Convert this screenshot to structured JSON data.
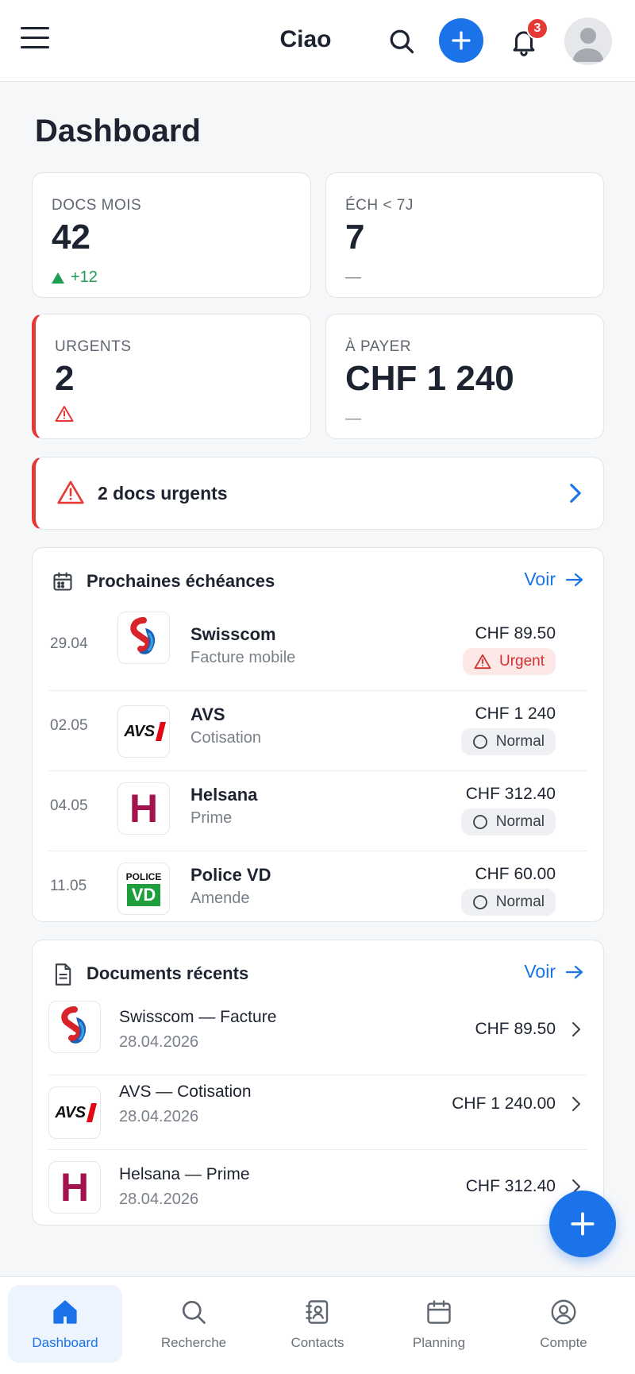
{
  "topbar": {
    "title": "Ciao",
    "notifications": "3"
  },
  "page": {
    "title": "Dashboard"
  },
  "stats": [
    {
      "label": "DOCS MOIS",
      "value": "42",
      "sub": "+12"
    },
    {
      "label": "ÉCH < 7J",
      "value": "7",
      "sub": "—"
    },
    {
      "label": "URGENTS",
      "value": "2",
      "sub": ""
    },
    {
      "label": "À PAYER",
      "value": "CHF 1 240",
      "sub": "—"
    }
  ],
  "banner": {
    "text": "2 docs urgents"
  },
  "deadlines": {
    "title": "Prochaines échéances",
    "see_label": "Voir",
    "items": [
      {
        "date": "29.04",
        "name": "Swisscom",
        "desc": "Facture mobile",
        "amount": "CHF 89.50",
        "status": "Urgent",
        "logo": "swisscom-logo"
      },
      {
        "date": "02.05",
        "name": "AVS",
        "desc": "Cotisation",
        "amount": "CHF 1 240",
        "status": "Normal",
        "logo": "avs-logo"
      },
      {
        "date": "04.05",
        "name": "Helsana",
        "desc": "Prime",
        "amount": "CHF 312.40",
        "status": "Normal",
        "logo": "helsana-logo"
      },
      {
        "date": "11.05",
        "name": "Police VD",
        "desc": "Amende",
        "amount": "CHF 60.00",
        "status": "Normal",
        "logo": "police-vd-logo"
      }
    ]
  },
  "recent": {
    "title": "Documents récents",
    "see_label": "Voir",
    "items": [
      {
        "name": "Swisscom — Facture",
        "date": "28.04.2026",
        "amount": "CHF 89.50",
        "logo": "swisscom-logo"
      },
      {
        "name": "AVS — Cotisation",
        "date": "28.04.2026",
        "amount": "CHF 1 240.00",
        "logo": "avs-logo"
      },
      {
        "name": "Helsana — Prime",
        "date": "28.04.2026",
        "amount": "CHF 312.40",
        "logo": "helsana-logo"
      }
    ]
  },
  "logos": {
    "avs_text": "AVS",
    "police_top": "POLICE",
    "police_bottom": "VD",
    "helsana_letter": "H"
  },
  "nav": [
    {
      "label": "Dashboard",
      "icon": "home-icon",
      "active": true
    },
    {
      "label": "Recherche",
      "icon": "search-icon"
    },
    {
      "label": "Contacts",
      "icon": "contacts-icon"
    },
    {
      "label": "Planning",
      "icon": "calendar-icon"
    },
    {
      "label": "Compte",
      "icon": "account-icon"
    }
  ],
  "colors": {
    "accent": "#1a73e8",
    "danger": "#e53935",
    "success": "#1f9d55"
  }
}
